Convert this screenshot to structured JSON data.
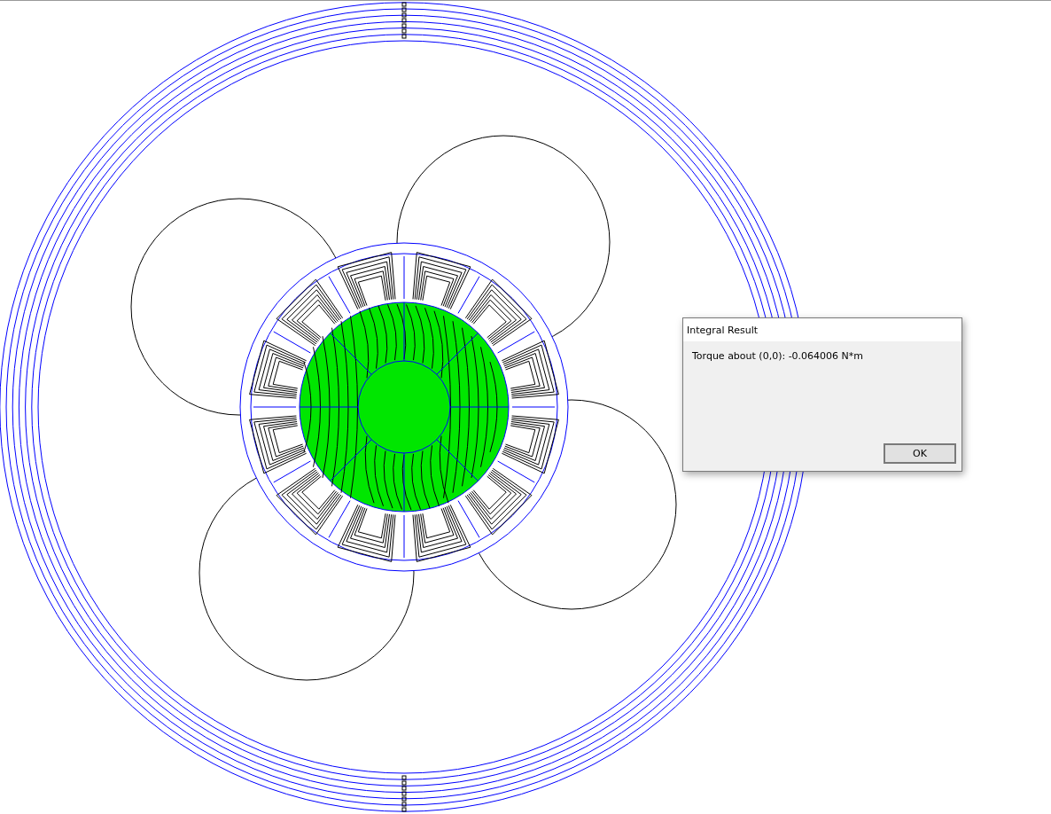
{
  "dialog": {
    "title": "Integral Result",
    "message": "Torque about (0,0): -0.064006 N*m",
    "buttons": [
      {
        "label": "OK",
        "kind": "default"
      }
    ]
  }
}
